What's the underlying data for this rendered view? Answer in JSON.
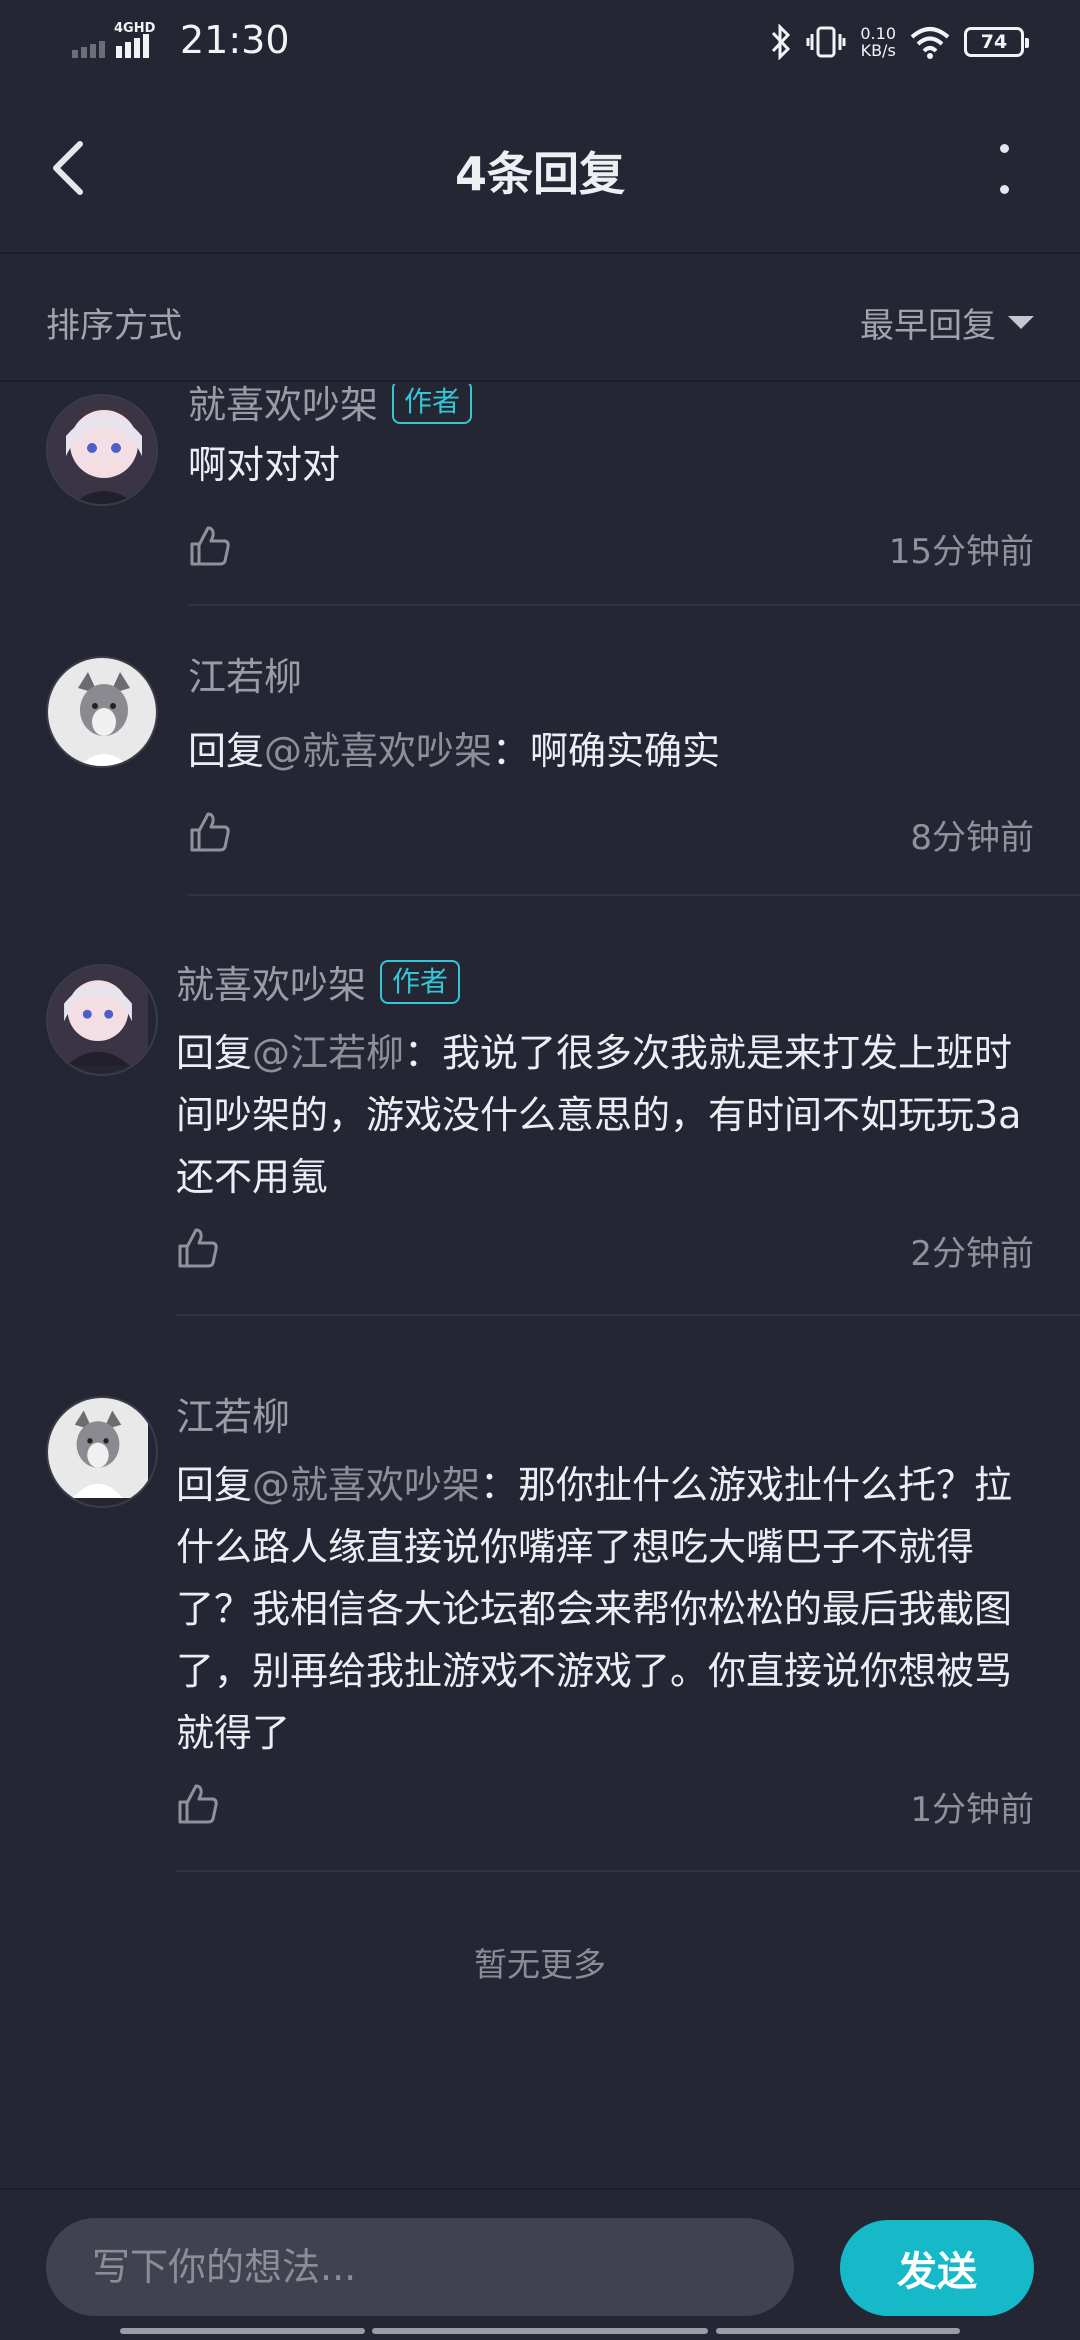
{
  "status_bar": {
    "network": "4GHD",
    "time": "21:30",
    "speed_value": "0.10",
    "speed_unit": "KB/s",
    "battery": "74"
  },
  "header": {
    "title": "4条回复"
  },
  "sort": {
    "label": "排序方式",
    "selected": "最早回复"
  },
  "comments": [
    {
      "author": "就喜欢吵架",
      "badge": "作者",
      "text": "啊对对对",
      "mention": "",
      "time": "15分钟前"
    },
    {
      "author": "江若柳",
      "badge": "",
      "reply_prefix": "回复",
      "mention": "@就喜欢吵架",
      "text": "：啊确实确实",
      "time": "8分钟前"
    },
    {
      "author": "就喜欢吵架",
      "badge": "作者",
      "reply_prefix": "回复",
      "mention": "@江若柳",
      "text": "：我说了很多次我就是来打发上班时间吵架的，游戏没什么意思的，有时间不如玩玩3a还不用氪",
      "time": "2分钟前"
    },
    {
      "author": "江若柳",
      "badge": "",
      "reply_prefix": "回复",
      "mention": "@就喜欢吵架",
      "text": "：那你扯什么游戏扯什么托？拉什么路人缘直接说你嘴痒了想吃大嘴巴子不就得了？我相信各大论坛都会来帮你松松的最后我截图了，别再给我扯游戏不游戏了。你直接说你想被骂就得了",
      "time": "1分钟前"
    }
  ],
  "footer_note": "暂无更多",
  "composer": {
    "placeholder": "写下你的想法...",
    "send_label": "发送"
  },
  "colors": {
    "background": "#242633",
    "accent": "#16b9c8",
    "badge": "#35c6d6"
  }
}
